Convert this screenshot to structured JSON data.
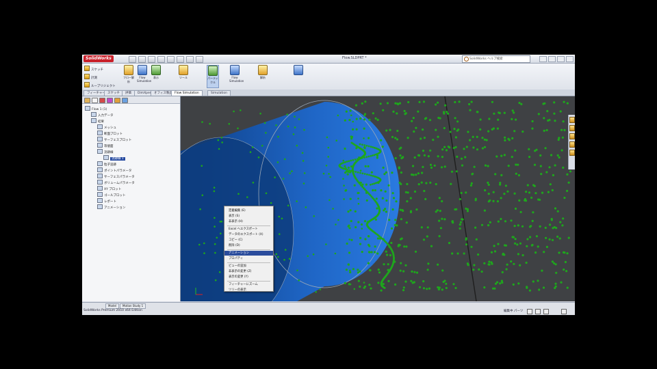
{
  "app": {
    "logo": "SolidWorks",
    "document_title": "Flow.SLDPRT *",
    "search_placeholder": "SolidWorks ヘルプ検索"
  },
  "command_manager": {
    "left_items": [
      "スケッチ",
      "計測",
      "ループリジェクト"
    ],
    "big_buttons": [
      "フロー解析",
      "Flow Simulation",
      "表示",
      "ツール",
      "パーティクル",
      "Flow Simulation",
      "解析"
    ],
    "small_labels": [
      "Flow Simulation",
      "解析"
    ]
  },
  "tabs": [
    "フィーチャー",
    "スケッチ",
    "評価",
    "DimXpert",
    "オフィス製品",
    "Flow Simulation",
    "Simulation"
  ],
  "active_tab": "Flow Simulation",
  "tree": {
    "items": [
      {
        "label": "Flow 1 (1)",
        "level": 0
      },
      {
        "label": "入力データ",
        "level": 1
      },
      {
        "label": "結果",
        "level": 1
      },
      {
        "label": "メッシュ",
        "level": 2
      },
      {
        "label": "断面プロット",
        "level": 2
      },
      {
        "label": "サーフェスプロット",
        "level": 2
      },
      {
        "label": "等値面",
        "level": 2
      },
      {
        "label": "流跡線",
        "level": 2
      },
      {
        "label": "流跡線 1",
        "level": 3
      },
      {
        "label": "粒子追跡",
        "level": 2
      },
      {
        "label": "ポイントパラメータ",
        "level": 2
      },
      {
        "label": "サーフェスパラメータ",
        "level": 2
      },
      {
        "label": "ボリュームパラメータ",
        "level": 2
      },
      {
        "label": "XY プロット",
        "level": 2
      },
      {
        "label": "ゴールプロット",
        "level": 2
      },
      {
        "label": "レポート",
        "level": 2
      },
      {
        "label": "アニメーション",
        "level": 2
      }
    ],
    "selected_index": 8
  },
  "context_menu": {
    "items": [
      {
        "label": "定義編集 (E)",
        "highlight": false
      },
      {
        "label": "表示 (S)",
        "highlight": false
      },
      {
        "label": "非表示 (H)",
        "highlight": false
      },
      {
        "label": "Excel へエクスポート",
        "highlight": false
      },
      {
        "label": "データのエクスポート (X)",
        "highlight": false
      },
      {
        "label": "コピー (C)",
        "highlight": false
      },
      {
        "label": "削除 (D)",
        "highlight": false
      },
      {
        "label": "アニメーション",
        "highlight": true
      },
      {
        "label": "プロパティ",
        "highlight": false
      },
      {
        "label": "ビューの追加",
        "highlight": false
      },
      {
        "label": "非表示の変更 (Z)",
        "highlight": false
      },
      {
        "label": "表示の変更 (Y)",
        "highlight": false
      },
      {
        "label": "フィーチャーにズーム",
        "highlight": false
      },
      {
        "label": "ツリーの表示",
        "highlight": false
      }
    ]
  },
  "panel_tabs": [
    "Model",
    "Motion Study 1"
  ],
  "status": {
    "message": "SolidWorks Premium 2010 x64 Edition",
    "right": "編集中 パーツ"
  },
  "viewport": {
    "background": "#3f4144",
    "cylinder_color": "#1f66c6",
    "particle_color": "#1ea71c"
  }
}
